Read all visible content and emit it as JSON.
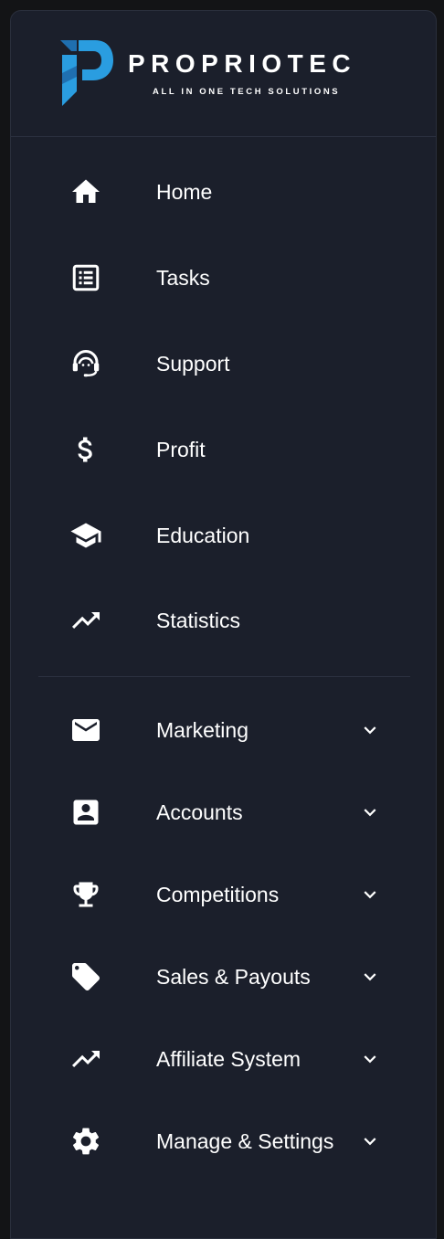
{
  "brand": {
    "name": "PROPRIOTEC",
    "tagline": "ALL IN ONE TECH SOLUTIONS",
    "colors": {
      "logo_primary": "#2a9de0",
      "logo_dark": "#1f6fb0"
    }
  },
  "theme": {
    "background": "#1b1f2b",
    "text": "#ffffff",
    "divider": "#2c3140"
  },
  "nav": {
    "primary": [
      {
        "label": "Home",
        "icon": "home-icon"
      },
      {
        "label": "Tasks",
        "icon": "list-icon"
      },
      {
        "label": "Support",
        "icon": "headset-icon"
      },
      {
        "label": "Profit",
        "icon": "dollar-icon"
      },
      {
        "label": "Education",
        "icon": "graduation-cap-icon"
      },
      {
        "label": "Statistics",
        "icon": "trending-up-icon"
      }
    ],
    "secondary": [
      {
        "label": "Marketing",
        "icon": "mail-icon",
        "expandable": true
      },
      {
        "label": "Accounts",
        "icon": "account-box-icon",
        "expandable": true
      },
      {
        "label": "Competitions",
        "icon": "trophy-icon",
        "expandable": true
      },
      {
        "label": "Sales & Payouts",
        "icon": "tag-icon",
        "expandable": true
      },
      {
        "label": "Affiliate System",
        "icon": "trending-up-icon",
        "expandable": true
      },
      {
        "label": "Manage & Settings",
        "icon": "gear-icon",
        "expandable": true
      }
    ]
  }
}
